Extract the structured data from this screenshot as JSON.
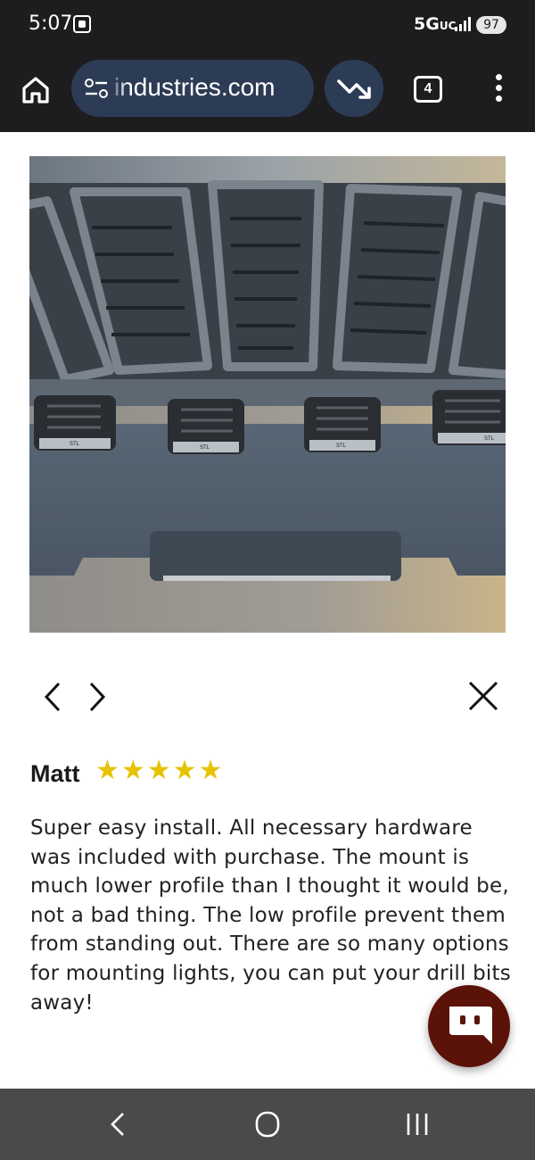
{
  "status_bar": {
    "time": "5:07",
    "network": "5G",
    "network_suffix": "UC",
    "battery": "97"
  },
  "browser": {
    "url": "industries.com",
    "tab_count": "4"
  },
  "review": {
    "reviewer": "Matt",
    "rating": 5,
    "stars": "★★★★★",
    "text": "Super easy install. All necessary hardware was included with purchase. The mount is much lower profile than I thought it would be, not a bad thing. The low profile prevent them from standing out. There are so many options for mounting lights, you can put your drill bits away!"
  },
  "photo": {
    "light_label": "STL"
  },
  "colors": {
    "star": "#e6c200",
    "chat_button": "#5b1208",
    "url_bar": "#2d3c55",
    "browser_bar": "#1d1d1f",
    "system_nav": "#4a4a4c"
  },
  "icons": [
    "screenshot-icon",
    "signal-icon",
    "home-icon",
    "tune-icon",
    "trending-down-icon",
    "tabs-icon",
    "more-vert-icon",
    "chevron-left-icon",
    "chevron-right-icon",
    "close-icon",
    "chat-icon",
    "back-icon",
    "home-circle-icon",
    "recents-icon"
  ]
}
